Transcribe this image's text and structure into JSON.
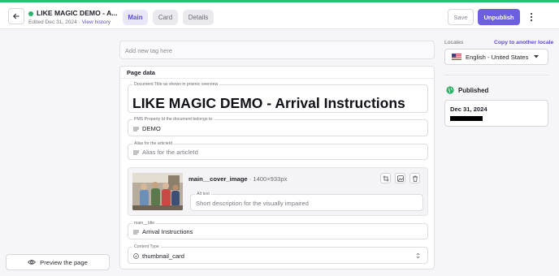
{
  "header": {
    "document_title": "LIKE MAGIC DEMO - A...",
    "edited_text": "Edited Dec 31, 2024 · ",
    "view_history": "View history",
    "status_color": "#27b467",
    "tabs": [
      {
        "label": "Main",
        "active": true
      },
      {
        "label": "Card",
        "active": false
      },
      {
        "label": "Details",
        "active": false
      }
    ],
    "save_label": "Save",
    "unpublish_label": "Unpublish",
    "back_icon": "arrow-left-icon",
    "more_icon": "more-vertical-icon"
  },
  "sidebar": {
    "preview_label": "Preview the page",
    "preview_icon": "eye-icon"
  },
  "tags": {
    "placeholder": "Add new tag here"
  },
  "page_data": {
    "heading": "Page data",
    "fields": {
      "document_title": {
        "label": "Document Title as shown in prismic overview",
        "value": "LIKE MAGIC DEMO - Arrival Instructions"
      },
      "pms_property": {
        "label": "PMS Property Id the document belongs to",
        "value": "DEMO"
      },
      "alias": {
        "label": "Alias for the articleId",
        "placeholder": "Alias for the articleId"
      },
      "cover_image": {
        "name": "main__cover_image",
        "dimensions": " · 1400×933px",
        "alt_label": "Alt text",
        "alt_placeholder": "Short description for the visually impaired",
        "actions": [
          "crop-icon",
          "image-replace-icon",
          "trash-icon"
        ]
      },
      "main_title": {
        "label": "main__title",
        "value": "Arrival Instructions"
      },
      "content_type": {
        "label": "Content Type",
        "value": "thumbnail_card"
      }
    }
  },
  "locales": {
    "label": "Locales",
    "copy_link": "Copy to another locale",
    "selected": "English - United States",
    "flag_icon": "us-flag-icon"
  },
  "publish": {
    "status": "Published",
    "status_icon": "globe-icon",
    "date": "Dec 31, 2024"
  },
  "colors": {
    "accent": "#6c5fe0",
    "link": "#5b4ccc",
    "published_green": "#27b467"
  }
}
